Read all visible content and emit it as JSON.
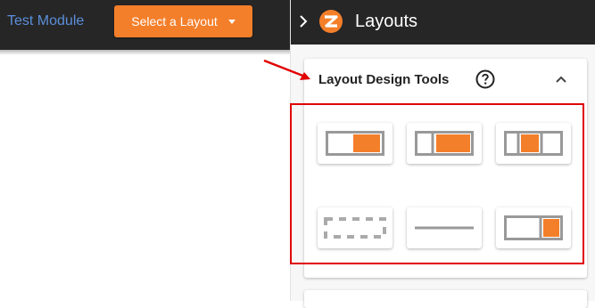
{
  "topbar": {
    "module_link": "Test Module",
    "layout_button": "Select a Layout"
  },
  "panel": {
    "title": "Layouts",
    "card_title": "Layout Design Tools"
  },
  "tools": [
    {
      "icon": "two-column-right-wide-icon"
    },
    {
      "icon": "two-column-left-narrow-icon"
    },
    {
      "icon": "three-column-center-highlight-icon"
    },
    {
      "icon": "dashed-spacer-icon"
    },
    {
      "icon": "horizontal-divider-icon"
    },
    {
      "icon": "two-column-right-narrow-icon"
    }
  ],
  "colors": {
    "accent": "#f47f2a",
    "dark": "#262626",
    "link": "#5b8fd9",
    "highlight": "#e00000",
    "tile_border": "#999999"
  }
}
